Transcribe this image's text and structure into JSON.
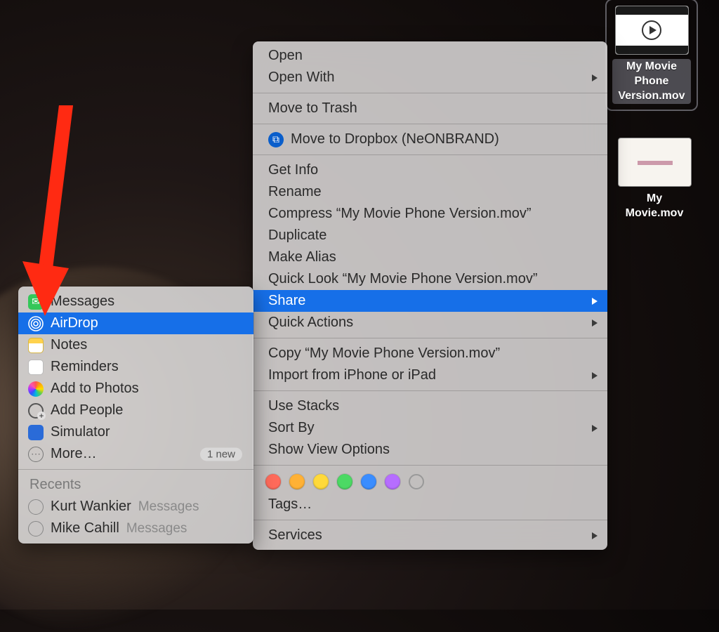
{
  "desktop": {
    "files": [
      {
        "name": "My Movie Phone Version.mov",
        "selected": true,
        "thumb": "video"
      },
      {
        "name": "My Movie.mov",
        "selected": false,
        "thumb": "plain"
      }
    ]
  },
  "context_menu": {
    "groups": [
      [
        {
          "label": "Open"
        },
        {
          "label": "Open With",
          "submenu": true
        }
      ],
      [
        {
          "label": "Move to Trash"
        }
      ],
      [
        {
          "label": "Move to Dropbox (NeONBRAND)",
          "icon": "dropbox"
        }
      ],
      [
        {
          "label": "Get Info"
        },
        {
          "label": "Rename"
        },
        {
          "label": "Compress “My Movie Phone Version.mov”"
        },
        {
          "label": "Duplicate"
        },
        {
          "label": "Make Alias"
        },
        {
          "label": "Quick Look “My Movie Phone Version.mov”"
        },
        {
          "label": "Share",
          "submenu": true,
          "highlight": true
        },
        {
          "label": "Quick Actions",
          "submenu": true
        }
      ],
      [
        {
          "label": "Copy “My Movie Phone Version.mov”"
        },
        {
          "label": "Import from iPhone or iPad",
          "submenu": true
        }
      ],
      [
        {
          "label": "Use Stacks"
        },
        {
          "label": "Sort By",
          "submenu": true
        },
        {
          "label": "Show View Options"
        }
      ]
    ],
    "tag_colors": [
      "#ff6b5b",
      "#ffb135",
      "#ffd93a",
      "#4cd964",
      "#3a8dff",
      "#b66dff"
    ],
    "tags_label": "Tags…",
    "services_label": "Services",
    "services_submenu": true
  },
  "share_submenu": {
    "items": [
      {
        "label": "Messages",
        "icon": "messages"
      },
      {
        "label": "AirDrop",
        "icon": "airdrop",
        "highlight": true
      },
      {
        "label": "Notes",
        "icon": "notes"
      },
      {
        "label": "Reminders",
        "icon": "reminders"
      },
      {
        "label": "Add to Photos",
        "icon": "photos"
      },
      {
        "label": "Add People",
        "icon": "people"
      },
      {
        "label": "Simulator",
        "icon": "simulator"
      },
      {
        "label": "More…",
        "icon": "more",
        "badge": "1 new"
      }
    ],
    "recents_header": "Recents",
    "recents": [
      {
        "name": "Kurt Wankier",
        "via": "Messages"
      },
      {
        "name": "Mike Cahill",
        "via": "Messages"
      }
    ]
  },
  "annotation": {
    "arrow_target": "AirDrop"
  }
}
